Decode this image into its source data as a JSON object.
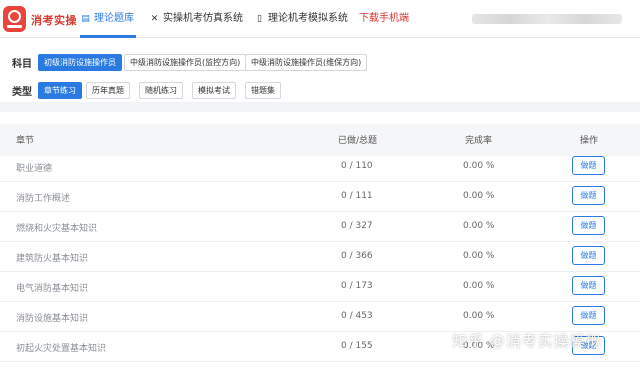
{
  "brand": {
    "name": "消考实操",
    "logo_icon": "fire-school-logo-icon"
  },
  "nav": {
    "items": [
      {
        "label": "理论题库",
        "icon": "file-text-icon"
      },
      {
        "label": "实操机考仿真系统",
        "icon": "tools-icon"
      },
      {
        "label": "理论机考模拟系统",
        "icon": "document-icon"
      }
    ],
    "download": "下载手机端",
    "active_index": 0
  },
  "filters": {
    "subject_label": "科目",
    "subjects": [
      "初级消防设施操作员",
      "中级消防设施操作员(监控方向)",
      "中级消防设施操作员(维保方向)"
    ],
    "type_label": "类型",
    "types": [
      "章节练习",
      "历年真题",
      "随机练习",
      "模拟考试",
      "错题集"
    ]
  },
  "table": {
    "headers": {
      "chapter": "章节",
      "done": "已做/总题",
      "rate": "完成率",
      "action": "操作"
    },
    "button_label": "做题",
    "rows": [
      {
        "chapter": "职业道德",
        "done": "0 / 110",
        "rate": "0.00 %"
      },
      {
        "chapter": "消防工作概述",
        "done": "0 / 111",
        "rate": "0.00 %"
      },
      {
        "chapter": "燃烧和火灾基本知识",
        "done": "0 / 327",
        "rate": "0.00 %"
      },
      {
        "chapter": "建筑防火基本知识",
        "done": "0 / 366",
        "rate": "0.00 %"
      },
      {
        "chapter": "电气消防基本知识",
        "done": "0 / 173",
        "rate": "0.00 %"
      },
      {
        "chapter": "消防设施基本知识",
        "done": "0 / 453",
        "rate": "0.00 %"
      },
      {
        "chapter": "初起火灾处置基本知识",
        "done": "0 / 155",
        "rate": "0.00 %"
      }
    ]
  },
  "watermark": "知乎 @消考实操模拟",
  "colors": {
    "accent": "#2a7ae2",
    "brand_red": "#d93a31"
  }
}
